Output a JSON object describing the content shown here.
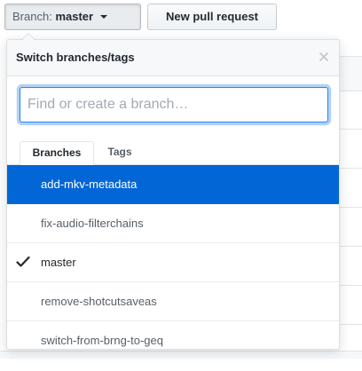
{
  "toolbar": {
    "branch_prefix": "Branch:",
    "branch_name": "master",
    "new_pr_label": "New pull request"
  },
  "dropdown": {
    "title": "Switch branches/tags",
    "filter_placeholder": "Find or create a branch…",
    "filter_value": "",
    "tabs": [
      {
        "label": "Branches",
        "active": true
      },
      {
        "label": "Tags",
        "active": false
      }
    ],
    "branches": [
      {
        "name": "add-mkv-metadata",
        "highlighted": true,
        "current": false
      },
      {
        "name": "fix-audio-filterchains",
        "highlighted": false,
        "current": false
      },
      {
        "name": "master",
        "highlighted": false,
        "current": true
      },
      {
        "name": "remove-shotcutsaveas",
        "highlighted": false,
        "current": false
      },
      {
        "name": "switch-from-brng-to-geq",
        "highlighted": false,
        "current": false
      }
    ]
  },
  "colors": {
    "accent": "#0366d6",
    "focus_border": "#2188ff"
  },
  "icons": {
    "caret": "caret-down-icon",
    "close": "close-icon",
    "current_branch": "check-icon"
  }
}
